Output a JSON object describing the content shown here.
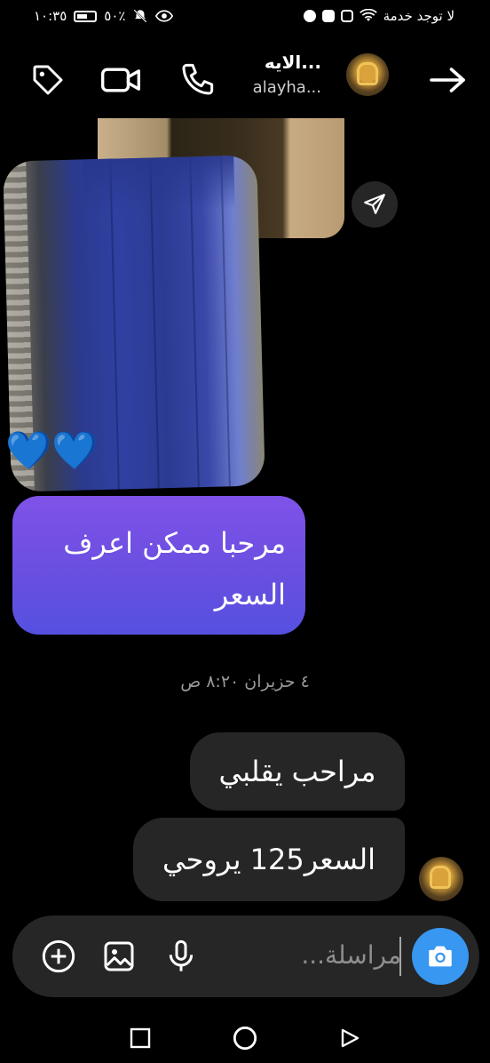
{
  "status_bar": {
    "time": "١٠:٣٥",
    "battery": "٥٠٪",
    "carrier": "لا توجد خدمة",
    "icons": [
      "battery-icon",
      "mute-icon",
      "eye-icon",
      "pinterest-icon",
      "youtube-icon",
      "instagram-icon",
      "wifi-icon"
    ]
  },
  "header": {
    "name": "الايه...",
    "handle": "alayha...",
    "icons": [
      "tag-icon",
      "video-call-icon",
      "phone-icon",
      "back-arrow-icon"
    ]
  },
  "thread": {
    "shared_media": {
      "hearts": "💙💙",
      "share_icon": "send-icon"
    },
    "messages": [
      {
        "side": "sent",
        "text": "مرحبا ممكن اعرف السعر"
      },
      {
        "side": "received",
        "text": "مراحب يقلبي"
      },
      {
        "side": "received",
        "text": "السعر125 يروحي"
      }
    ],
    "timestamp": "٤ حزيران ٨:٢٠ ص"
  },
  "composer": {
    "placeholder": "مراسلة...",
    "icons": [
      "camera-icon",
      "mic-icon",
      "gallery-icon",
      "add-icon"
    ]
  },
  "nav_bar": {
    "icons": [
      "recents-icon",
      "home-icon",
      "back-icon"
    ]
  },
  "colors": {
    "background": "#000000",
    "sent_bubble_top": "#7f52e8",
    "sent_bubble_bottom": "#5550e0",
    "received_bubble": "#262626",
    "camera_button": "#3897f0",
    "timestamp_text": "#9a9a9a"
  }
}
